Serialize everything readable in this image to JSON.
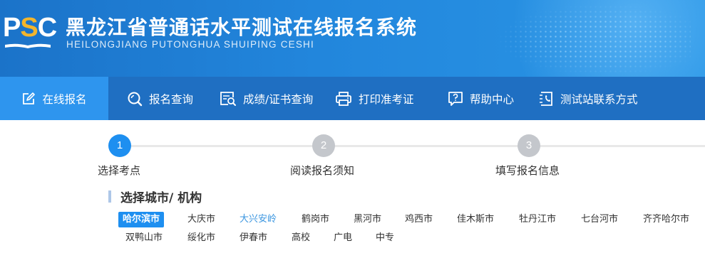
{
  "header": {
    "logo_text_p": "P",
    "logo_text_s": "S",
    "logo_text_c": "C",
    "title": "黑龙江省普通话水平测试在线报名系统",
    "subtitle": "HEILONGJIANG PUTONGHUA SHUIPING CESHI",
    "brand_color": "#1f6fc2",
    "accent_color": "#f3b52c"
  },
  "nav": {
    "items": [
      {
        "label": "在线报名",
        "icon": "edit-icon",
        "active": true
      },
      {
        "label": "报名查询",
        "icon": "search-icon"
      },
      {
        "label": "成绩/证书查询",
        "icon": "certificate-search-icon"
      },
      {
        "label": "打印准考证",
        "icon": "printer-icon"
      },
      {
        "label": "帮助中心",
        "icon": "help-chat-icon"
      },
      {
        "label": "测试站联系方式",
        "icon": "phone-book-icon"
      }
    ]
  },
  "steps": [
    {
      "number": "1",
      "label": "选择考点",
      "active": true
    },
    {
      "number": "2",
      "label": "阅读报名须知"
    },
    {
      "number": "3",
      "label": "填写报名信息"
    }
  ],
  "section": {
    "title": "选择城市/ 机构"
  },
  "cities": {
    "row1": [
      "哈尔滨市",
      "大庆市",
      "大兴安岭",
      "鹤岗市",
      "黑河市",
      "鸡西市",
      "佳木斯市",
      "牡丹江市",
      "七台河市",
      "齐齐哈尔市"
    ],
    "row2": [
      "双鸭山市",
      "绥化市",
      "伊春市",
      "高校",
      "广电",
      "中专"
    ],
    "selected": "哈尔滨市",
    "highlighted": "大兴安岭",
    "selected_color": "#1e8ff0"
  }
}
